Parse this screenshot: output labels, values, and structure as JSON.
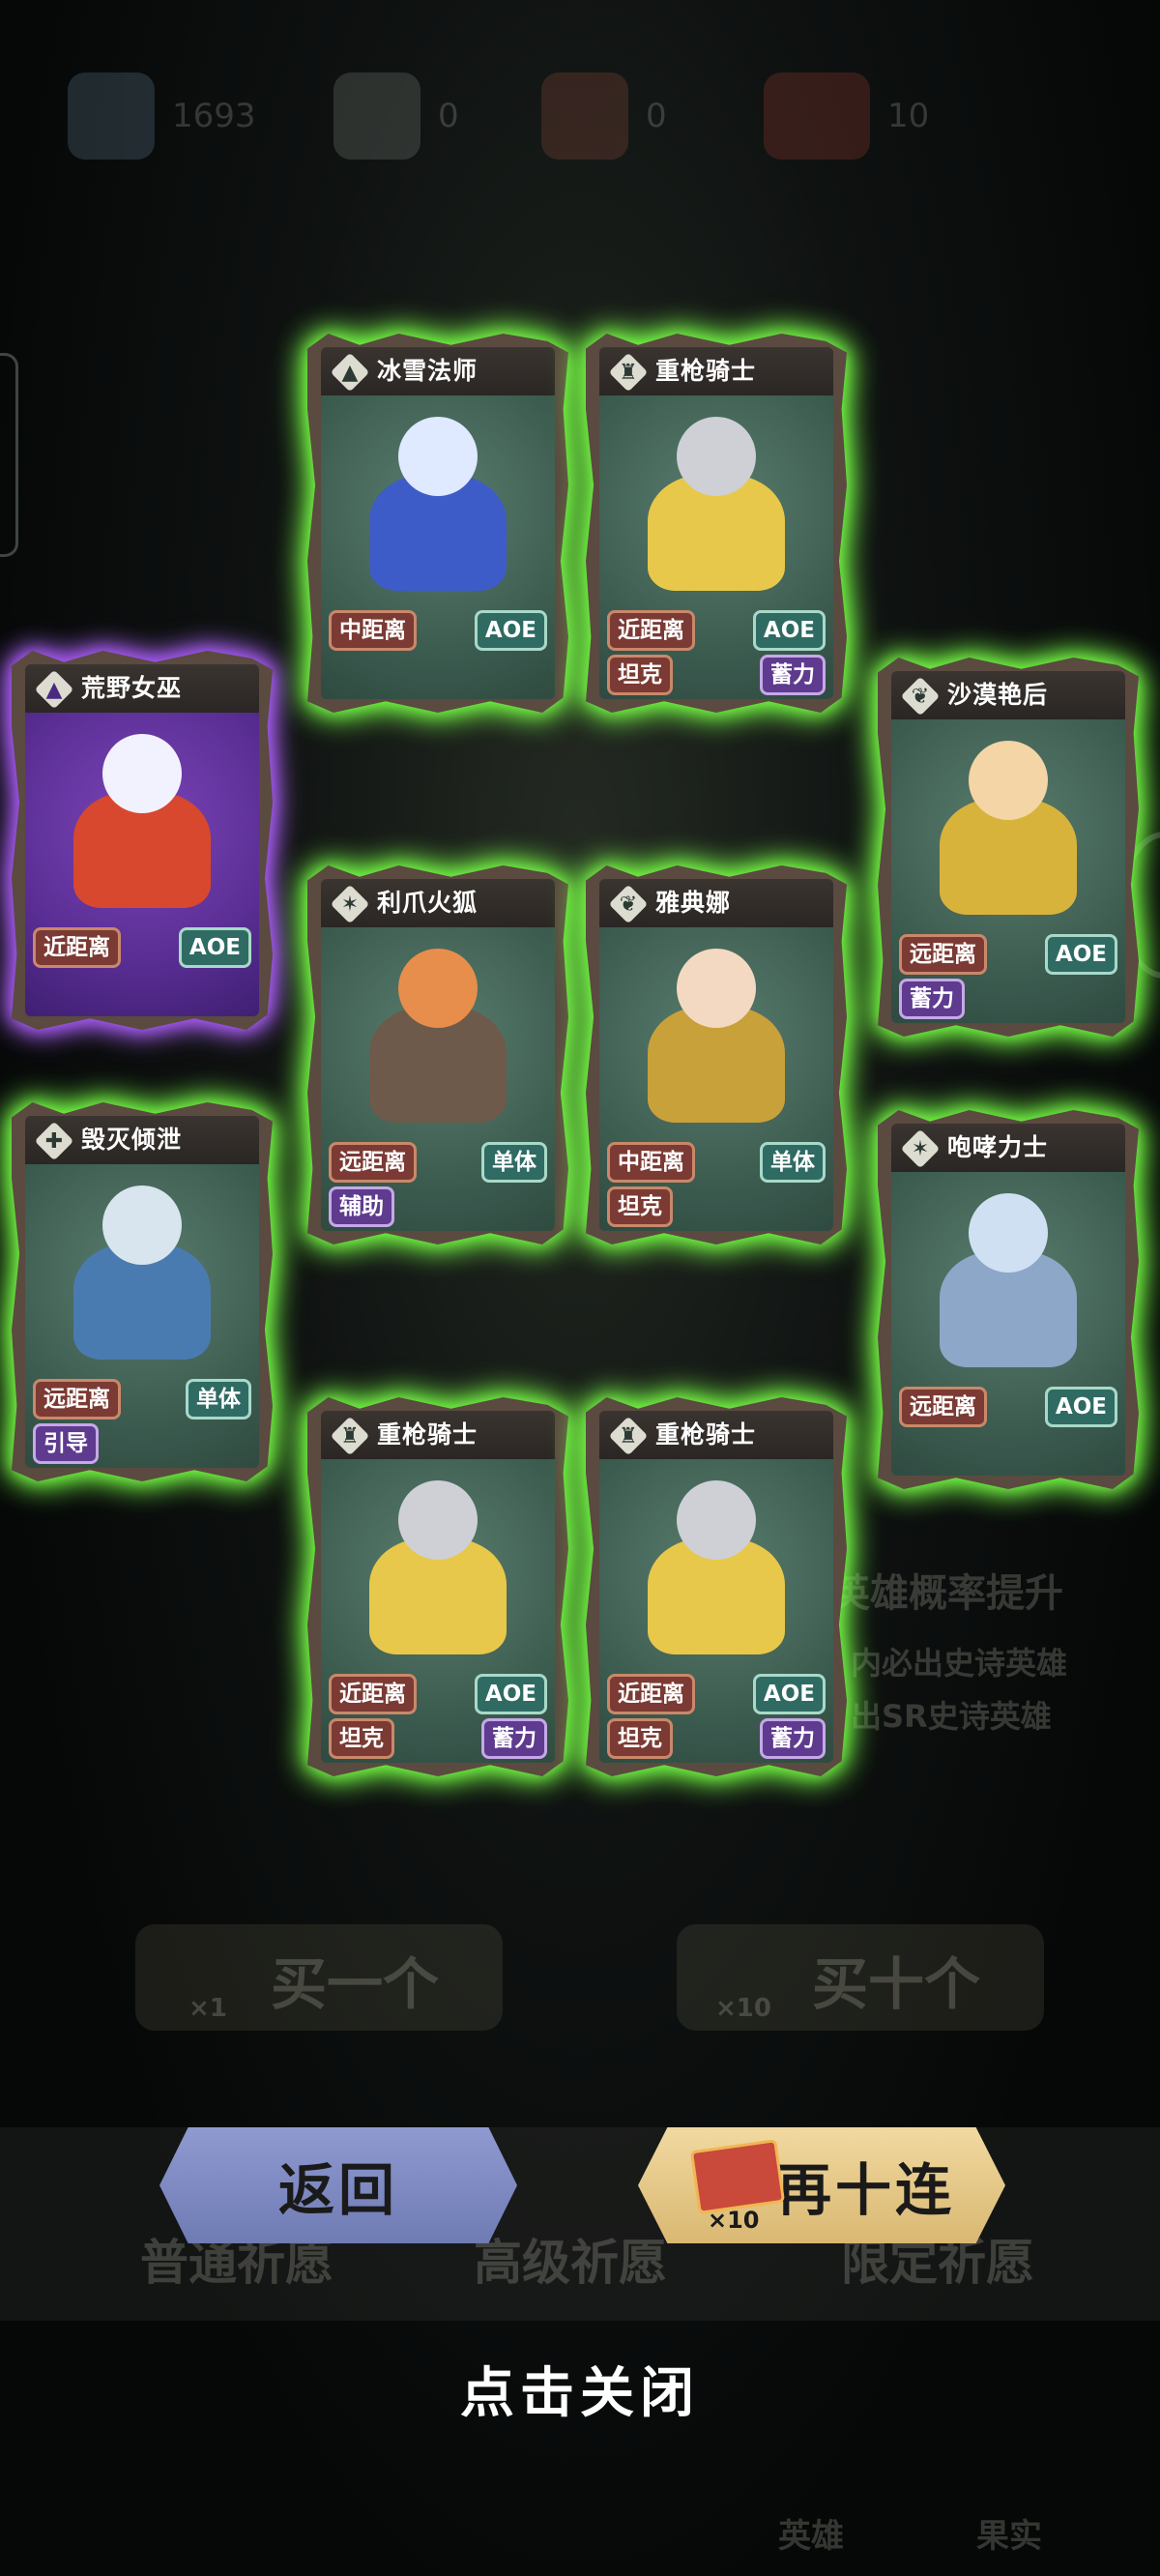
{
  "topbar": {
    "gems": "1693",
    "item2": "0",
    "item3": "0",
    "tickets": "10"
  },
  "background": {
    "hero_prob": "英雄概率提升",
    "line1": "内必出史诗英雄",
    "line2": "出SR史诗英雄",
    "buy_one": "买一个",
    "buy_ten": "买十个",
    "buy_one_count": "×1",
    "buy_ten_count": "×10",
    "tab1": "普通祈愿",
    "tab2": "高级祈愿",
    "tab3": "限定祈愿",
    "nav_hero": "英雄",
    "nav_fruit": "果实"
  },
  "cards": [
    {
      "name": "荒野女巫",
      "role": "magic",
      "rarity": "purple",
      "tags": [
        [
          "近距离",
          "AOE"
        ],
        []
      ]
    },
    {
      "name": "冰雪法师",
      "role": "magic",
      "rarity": "green",
      "tags": [
        [
          "中距离",
          "AOE"
        ],
        []
      ]
    },
    {
      "name": "重枪骑士",
      "role": "tank",
      "rarity": "green",
      "tags": [
        [
          "近距离",
          "AOE"
        ],
        [
          "坦克",
          "蓄力"
        ]
      ]
    },
    {
      "name": "沙漠艳后",
      "role": "wing",
      "rarity": "green",
      "tags": [
        [
          "远距离",
          "AOE"
        ],
        [
          "蓄力"
        ]
      ]
    },
    {
      "name": "利爪火狐",
      "role": "claw",
      "rarity": "green",
      "tags": [
        [
          "远距离",
          "单体"
        ],
        [
          "辅助"
        ]
      ]
    },
    {
      "name": "雅典娜",
      "role": "wing",
      "rarity": "green",
      "tags": [
        [
          "中距离",
          "单体"
        ],
        [
          "坦克"
        ]
      ]
    },
    {
      "name": "毁灭倾泄",
      "role": "wrench",
      "rarity": "green",
      "tags": [
        [
          "远距离",
          "单体"
        ],
        [
          "引导"
        ]
      ]
    },
    {
      "name": "咆哮力士",
      "role": "claw",
      "rarity": "green",
      "tags": [
        [
          "远距离",
          "AOE"
        ],
        []
      ]
    },
    {
      "name": "重枪骑士",
      "role": "tank",
      "rarity": "green",
      "tags": [
        [
          "近距离",
          "AOE"
        ],
        [
          "坦克",
          "蓄力"
        ]
      ]
    },
    {
      "name": "重枪骑士",
      "role": "tank",
      "rarity": "green",
      "tags": [
        [
          "近距离",
          "AOE"
        ],
        [
          "坦克",
          "蓄力"
        ]
      ]
    }
  ],
  "buttons": {
    "back": "返回",
    "again": "再十连",
    "again_count": "×10"
  },
  "close_hint": "点击关闭",
  "colors": {
    "green_glow": "#66ff3a",
    "purple_glow": "#a24bff",
    "back_button": "#7f8bc2",
    "again_button": "#e4c688"
  }
}
